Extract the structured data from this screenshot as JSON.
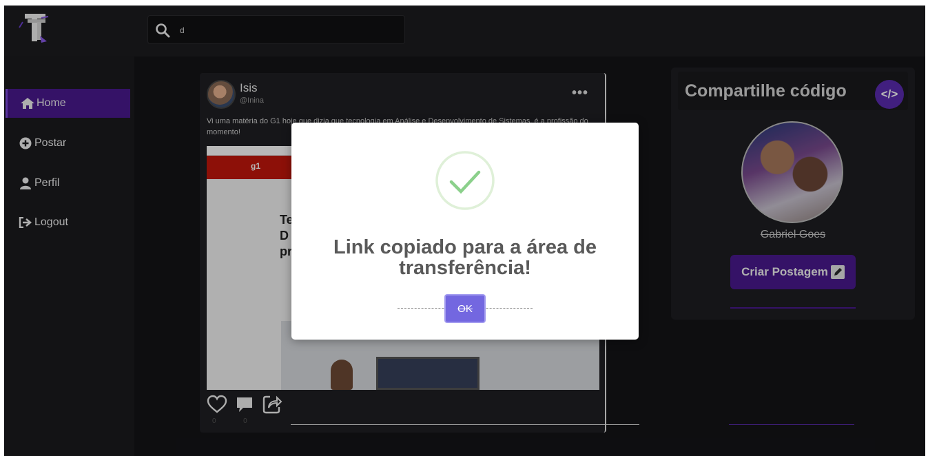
{
  "header": {
    "search": {
      "value": "d",
      "placeholder": ""
    }
  },
  "sidebar": {
    "items": [
      {
        "label": "Home",
        "icon": "home-icon",
        "active": true
      },
      {
        "label": "Postar",
        "icon": "plus-circle-icon",
        "active": false
      },
      {
        "label": "Perfil",
        "icon": "user-icon",
        "active": false
      },
      {
        "label": "Logout",
        "icon": "logout-icon",
        "active": false
      }
    ]
  },
  "post": {
    "author_name": "Isis",
    "author_handle": "@Inina",
    "menu": "•••",
    "text": "Vi uma matéria do G1 hoje que dizia que tecnologia em Análise e Desenvolvimento de Sistemas, é a profissão do momento!",
    "image": {
      "brand": "g1",
      "heading_fragment": "Te\nD\npr"
    },
    "likes": "0",
    "comments": "0"
  },
  "right_panel": {
    "title": "Compartilhe código",
    "code_badge": "</>",
    "user_name": "Gabriel Goes",
    "create_button": "Criar Postagem"
  },
  "modal": {
    "title": "Link copiado para a área de transferência!",
    "ok_label": "OK"
  },
  "colors": {
    "accent": "#4a1a8f",
    "ok_button": "#7367e0",
    "success": "#8bd08b",
    "background": "#18171c"
  }
}
